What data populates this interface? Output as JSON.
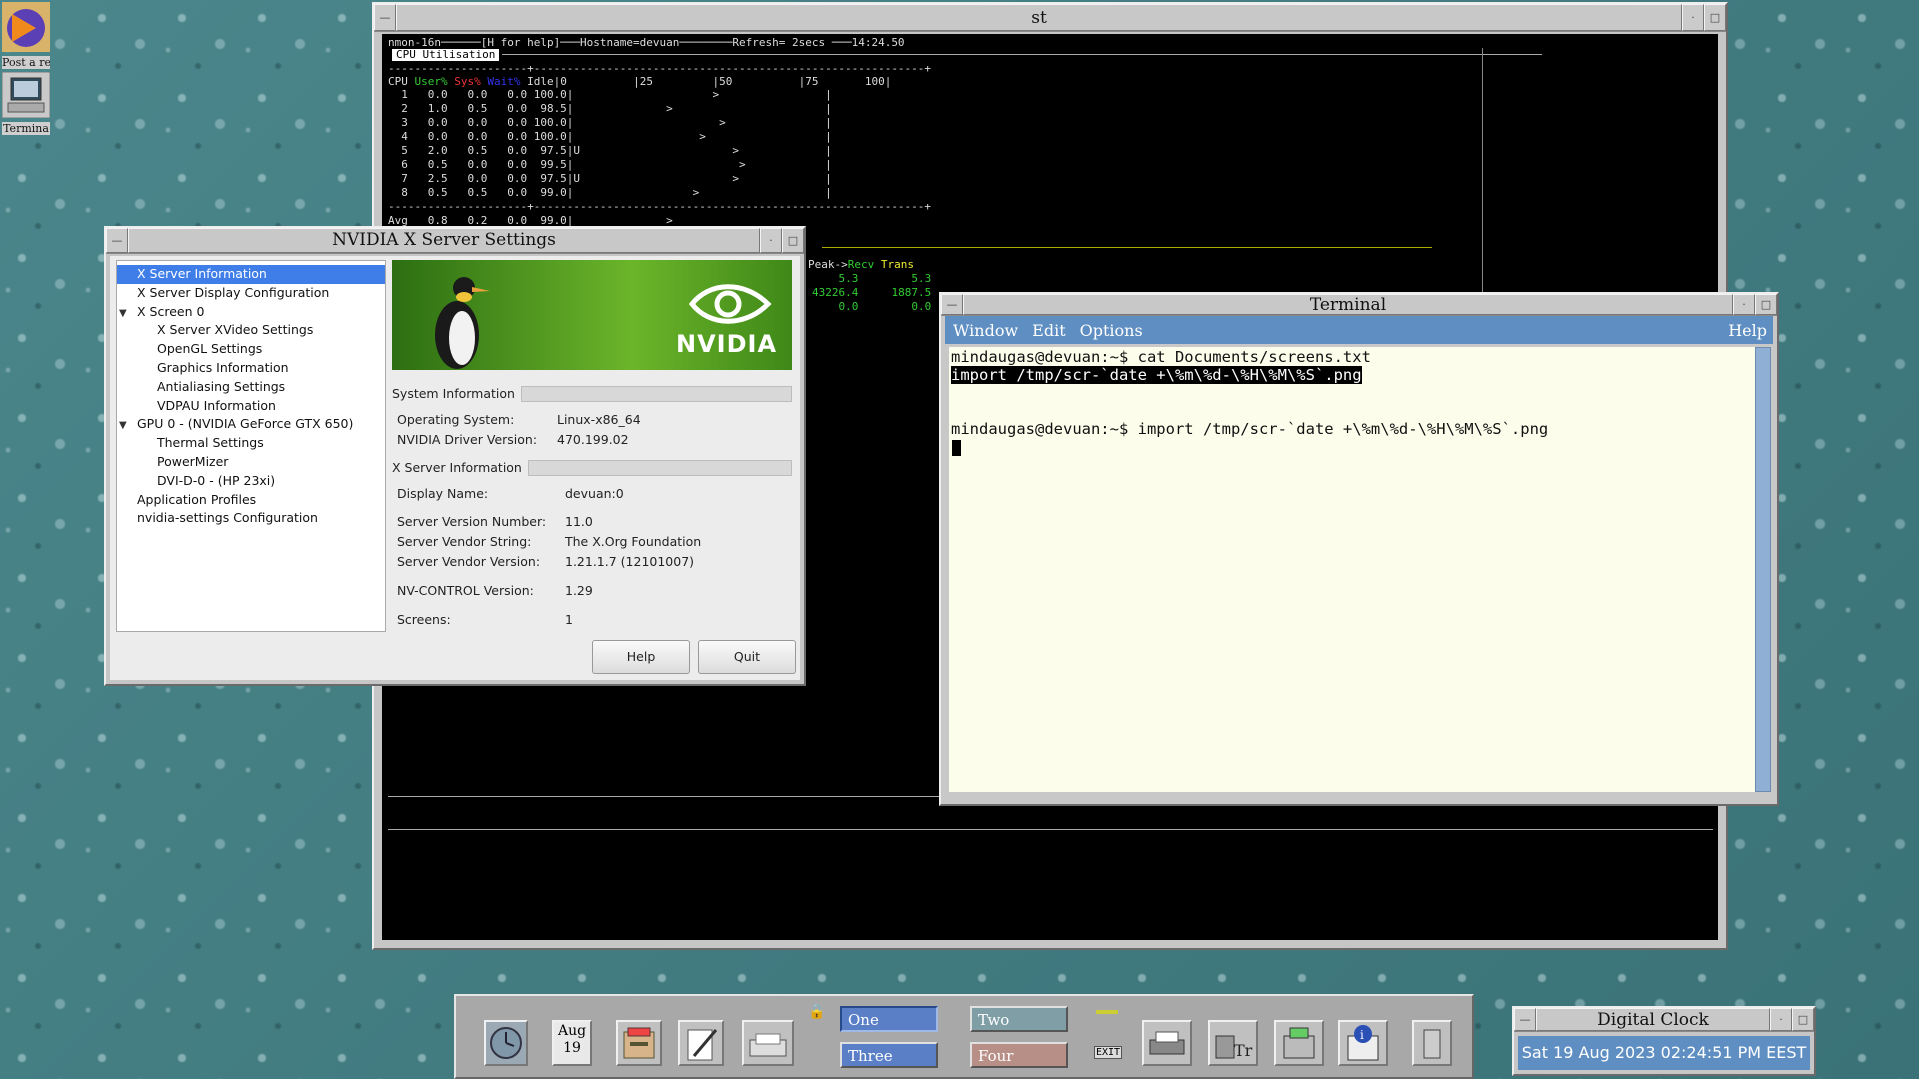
{
  "desktop": {
    "icon1_label": "Post a re",
    "icon2_label": "Termina"
  },
  "st": {
    "title": "st",
    "header": "nmon-16n──────[H for help]───Hostname=devuan────────Refresh= 2secs ───14:24.50",
    "tab_label": "CPU Utilisation",
    "dashes": "---------------------+-----------------------------------------------------------+",
    "col_header": {
      "cpu": "CPU",
      "user": "User%",
      "sys": "Sys%",
      "wait": "Wait%",
      "idle_scale": "Idle|0          |25         |50          |75       100|"
    },
    "rows": [
      {
        "line": "  1   0.0   0.0   0.0 100.0|                     >                |"
      },
      {
        "line": "  2   1.0   0.5   0.0  98.5|              >                       |"
      },
      {
        "line": "  3   0.0   0.0   0.0 100.0|                      >               |"
      },
      {
        "line": "  4   0.0   0.0   0.0 100.0|                   >                  |"
      },
      {
        "line": "  5   2.0   0.5   0.0  97.5|U                       >             |"
      },
      {
        "line": "  6   0.5   0.0   0.0  99.5|                         >            |"
      },
      {
        "line": "  7   2.5   0.0   0.0  97.5|U                       >             |"
      },
      {
        "line": "  8   0.5   0.5   0.0  99.0|                  >                   |"
      }
    ],
    "avg": "Avg   0.8   0.2   0.0  99.0|              >",
    "net_header_peak": "Peak->",
    "net_header_recv": "Recv",
    "net_header_trans": "Trans",
    "net_rows": [
      "    5.3        5.3",
      "43226.4     1887.5",
      "    0.0        0.0"
    ]
  },
  "nvidia": {
    "title": "NVIDIA X Server Settings",
    "tree": [
      {
        "label": "X Server Information",
        "level": 0,
        "selected": true
      },
      {
        "label": "X Server Display Configuration",
        "level": 0
      },
      {
        "label": "X Screen 0",
        "level": 0,
        "expander": "▼"
      },
      {
        "label": "X Server XVideo Settings",
        "level": 1
      },
      {
        "label": "OpenGL Settings",
        "level": 1
      },
      {
        "label": "Graphics Information",
        "level": 1
      },
      {
        "label": "Antialiasing Settings",
        "level": 1
      },
      {
        "label": "VDPAU Information",
        "level": 1
      },
      {
        "label": "GPU 0 - (NVIDIA GeForce GTX 650)",
        "level": 0,
        "expander": "▼"
      },
      {
        "label": "Thermal Settings",
        "level": 1
      },
      {
        "label": "PowerMizer",
        "level": 1
      },
      {
        "label": "DVI-D-0 - (HP 23xi)",
        "level": 1
      },
      {
        "label": "Application Profiles",
        "level": 0
      },
      {
        "label": "nvidia-settings Configuration",
        "level": 0
      }
    ],
    "logo_text": "NVIDIA",
    "system_section": "System Information",
    "os_label": "Operating System:",
    "os_value": "Linux-x86_64",
    "driver_label": "NVIDIA Driver Version:",
    "driver_value": "470.199.02",
    "xserver_section": "X Server Information",
    "display_label": "Display Name:",
    "display_value": "devuan:0",
    "svn_label": "Server Version Number:",
    "svn_value": "11.0",
    "vendor_label": "Server Vendor String:",
    "vendor_value": "The X.Org Foundation",
    "vendorver_label": "Server Vendor Version:",
    "vendorver_value": "1.21.1.7 (12101007)",
    "nvctrl_label": "NV-CONTROL Version:",
    "nvctrl_value": "1.29",
    "screens_label": "Screens:",
    "screens_value": "1",
    "help_button": "Help",
    "quit_button": "Quit"
  },
  "terminal": {
    "title": "Terminal",
    "menu": {
      "window": "Window",
      "edit": "Edit",
      "options": "Options",
      "help": "Help"
    },
    "lines": [
      "mindaugas@devuan:~$ cat Documents/screens.txt",
      "import /tmp/scr-`date +\\%m\\%d-\\%H\\%M\\%S`.png",
      "",
      "",
      "mindaugas@devuan:~$ import /tmp/scr-`date +\\%m\\%d-\\%H\\%M\\%S`.png"
    ]
  },
  "panel": {
    "cal_month": "Aug",
    "cal_day": "19",
    "workspaces": [
      "One",
      "Two",
      "Three",
      "Four"
    ],
    "exit_label": "EXIT",
    "colors": {
      "ws_active": "#5b7fc6",
      "ws_two": "#7f9ea6",
      "ws_four": "#b88f86"
    }
  },
  "clock": {
    "title": "Digital Clock",
    "time": "Sat 19 Aug 2023 02:24:51 PM EEST"
  }
}
